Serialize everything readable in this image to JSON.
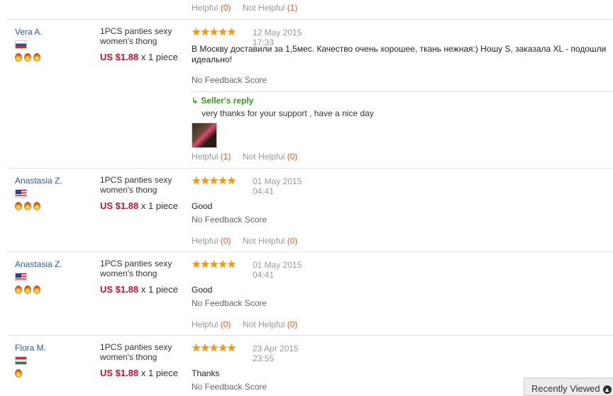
{
  "top_helpful": {
    "helpful_label": "Helpful",
    "helpful_count": "(0)",
    "not_helpful_label": "Not Helpful",
    "not_helpful_count": "(1)"
  },
  "reviews": [
    {
      "buyer": "Vera A.",
      "flag": "ru",
      "medals": 3,
      "product_title": "1PCS panties sexy women's thong",
      "price": "US $1.88",
      "qty": "x 1 piece",
      "stars": "★★★★★",
      "date": "12 May 2015",
      "time": "17:33",
      "text": "В Москву доставили за 1,5мес. Качество очень хорошее, ткань нежная:) Ношу S, заказала XL - подошли идеально!",
      "feedback_score": "No Feedback Score",
      "reply_title": "Seller's reply",
      "reply_text": "very thanks for your support , have a nice day",
      "helpful_label": "Helpful",
      "helpful_count": "(1)",
      "not_helpful_label": "Not Helpful",
      "not_helpful_count": "(0)"
    },
    {
      "buyer": "Anastasia Z.",
      "flag": "us",
      "medals": 3,
      "product_title": "1PCS panties sexy women's thong",
      "price": "US $1.88",
      "qty": "x 1 piece",
      "stars": "★★★★★",
      "date": "01 May 2015",
      "time": "04:41",
      "text": "Good",
      "feedback_score": "No Feedback Score",
      "helpful_label": "Helpful",
      "helpful_count": "(0)",
      "not_helpful_label": "Not Helpful",
      "not_helpful_count": "(0)"
    },
    {
      "buyer": "Anastasia Z.",
      "flag": "us",
      "medals": 3,
      "product_title": "1PCS panties sexy women's thong",
      "price": "US $1.88",
      "qty": "x 1 piece",
      "stars": "★★★★★",
      "date": "01 May 2015",
      "time": "04:41",
      "text": "Good",
      "feedback_score": "No Feedback Score",
      "helpful_label": "Helpful",
      "helpful_count": "(0)",
      "not_helpful_label": "Not Helpful",
      "not_helpful_count": "(0)"
    },
    {
      "buyer": "Flora M.",
      "flag": "hu",
      "medals": 1,
      "product_title": "1PCS panties sexy women's thong",
      "price": "US $1.88",
      "qty": "x 1 piece",
      "stars": "★★★★★",
      "date": "23 Apr 2015",
      "time": "23:55",
      "text": "Thanks",
      "feedback_score": "No Feedback Score"
    }
  ],
  "recently_viewed": "Recently Viewed"
}
